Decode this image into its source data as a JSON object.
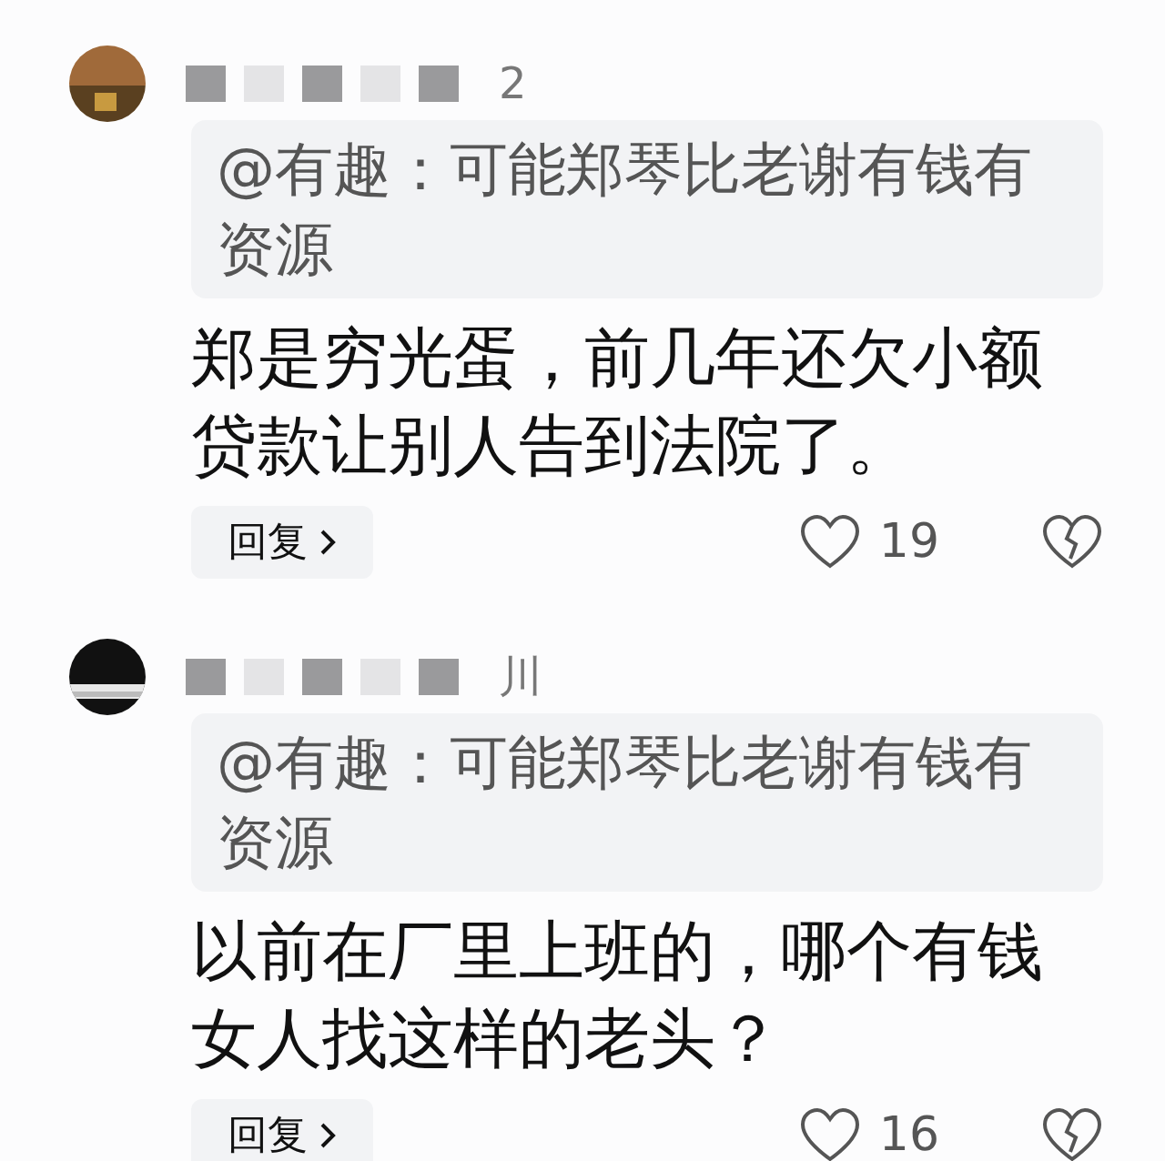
{
  "comments": [
    {
      "name_fragment": "2",
      "quote": "@有趣：可能郑琴比老谢有钱有资源",
      "text": "郑是穷光蛋，前几年还欠小额贷款让别人告到法院了。",
      "reply": "回复",
      "likes": "19"
    },
    {
      "name_fragment": "川",
      "quote": "@有趣：可能郑琴比老谢有钱有资源",
      "text": "以前在厂里上班的，哪个有钱女人找这样的老头？",
      "reply": "回复",
      "likes": "16"
    }
  ]
}
